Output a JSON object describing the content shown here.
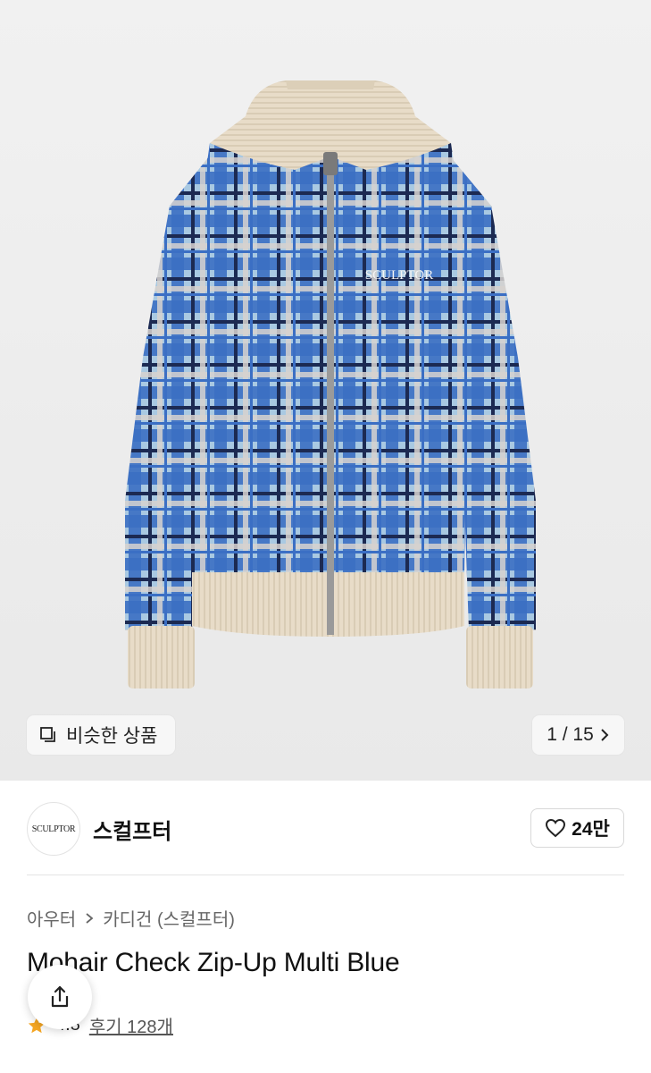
{
  "gallery": {
    "similar_label": "비슷한 상품",
    "counter": "1 / 15",
    "product_logo_text": "SCULPTOR"
  },
  "brand": {
    "logo_text": "SCULPTOR",
    "name": "스컬프터",
    "likes": "24만"
  },
  "breadcrumb": {
    "category": "아우터",
    "subcategory": "카디건 (스컬프터)"
  },
  "product": {
    "title": "Mohair Check Zip-Up Multi Blue"
  },
  "rating": {
    "score": "4.8",
    "reviews": "후기 128개"
  },
  "colors": {
    "plaid_blue": "#3b6fc4",
    "plaid_light": "#a9c9e2",
    "rib_beige": "#e8dcc8",
    "star": "#f5a623"
  }
}
